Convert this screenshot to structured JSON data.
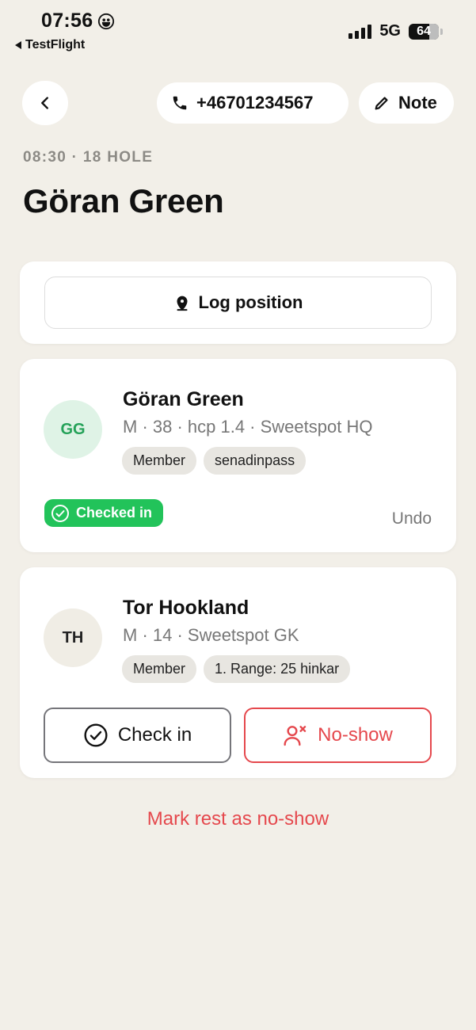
{
  "status_bar": {
    "time": "07:56",
    "back_app": "TestFlight",
    "network": "5G",
    "battery": "64"
  },
  "header": {
    "phone": "+46701234567",
    "note_label": "Note",
    "icons": {
      "back": "chevron-left-icon",
      "phone": "phone-icon",
      "note": "pencil-icon"
    }
  },
  "booking": {
    "meta": "08:30 · 18 HOLE",
    "title": "Göran Green"
  },
  "log_position": {
    "label": "Log position",
    "icon": "map-pin-icon"
  },
  "players": [
    {
      "initials": "GG",
      "name": "Göran Green",
      "info": "M · 38 · hcp 1.4 · Sweetspot HQ",
      "tags": [
        "Member",
        "senadinpass"
      ],
      "status": "Checked in",
      "undo_label": "Undo"
    },
    {
      "initials": "TH",
      "name": "Tor Hookland",
      "info": "M · 14 · Sweetspot GK",
      "tags": [
        "Member",
        "1. Range: 25 hinkar"
      ],
      "checkin_label": "Check in",
      "noshow_label": "No-show"
    }
  ],
  "mark_rest_label": "Mark rest as no-show",
  "colors": {
    "background": "#f2efe8",
    "success": "#22c35a",
    "danger": "#e5484d",
    "avatar_green_bg": "#dff3e6"
  }
}
